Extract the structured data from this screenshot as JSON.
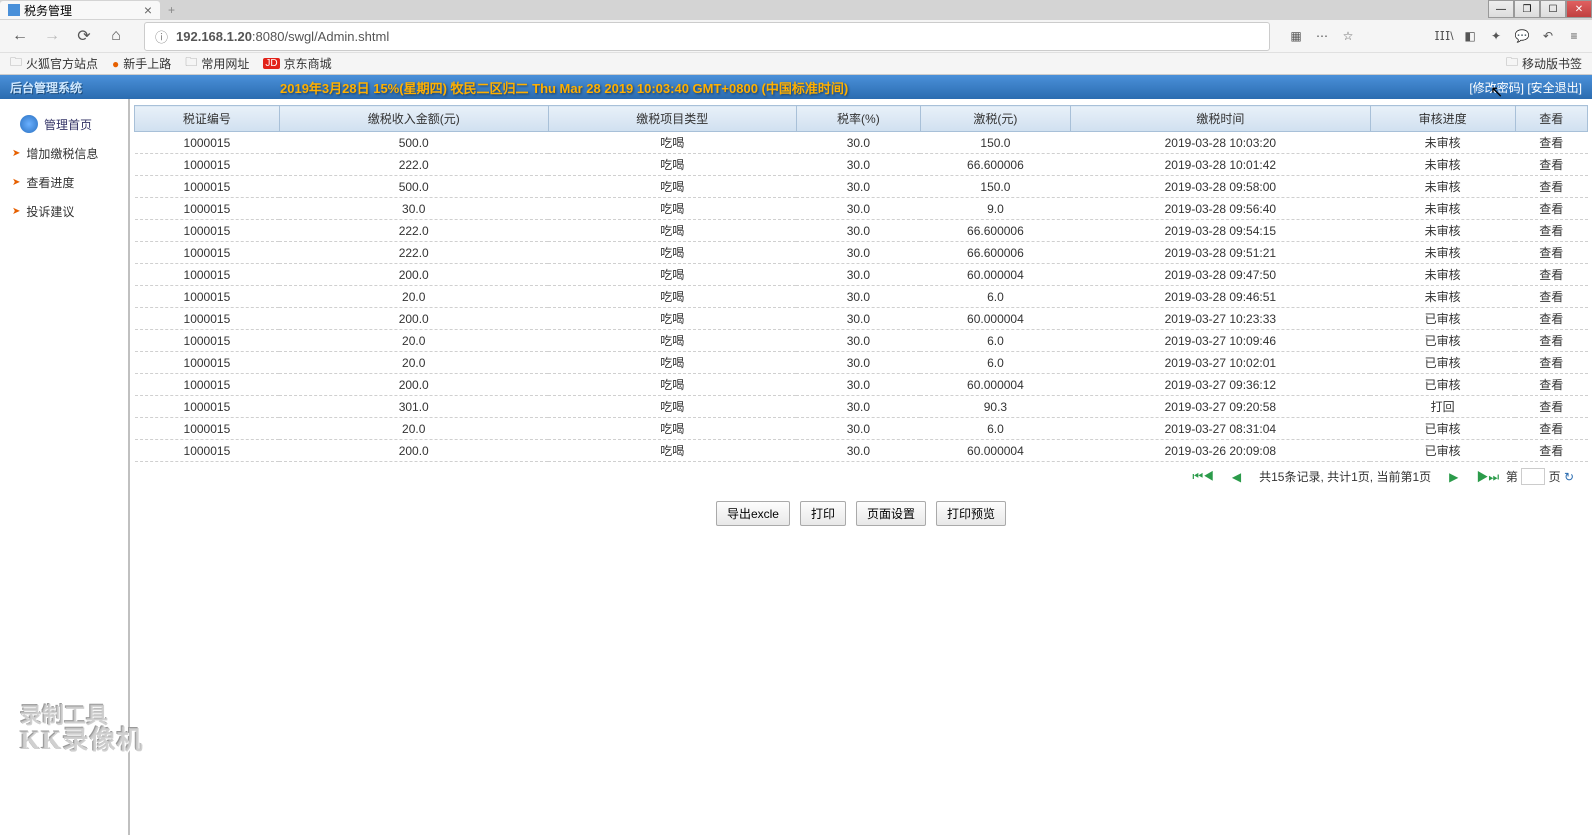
{
  "browser": {
    "tab_title": "税务管理",
    "url_display": "192.168.1.20:8080/swgl/Admin.shtml",
    "url_prefix": "192.168.1.20",
    "url_suffix": ":8080/swgl/Admin.shtml",
    "bookmarks": {
      "b1": "火狐官方站点",
      "b2": "新手上路",
      "b3": "常用网址",
      "b4": "京东商城",
      "right": "移动版书签"
    }
  },
  "app": {
    "logo": "后台管理系统",
    "marquee": "2019年3月28日 15%(星期四) 牧民二区归二 Thu Mar 28 2019 10:03:40 GMT+0800 (中国标准时间)",
    "change_pw": "[修改密码]",
    "logout": "[安全退出]"
  },
  "sidebar": {
    "home": "管理首页",
    "items": [
      {
        "label": "增加缴税信息"
      },
      {
        "label": "查看进度"
      },
      {
        "label": "投诉建议"
      }
    ]
  },
  "table": {
    "headers": {
      "id": "税证编号",
      "income": "缴税收入金额(元)",
      "type": "缴税项目类型",
      "rate": "税率(%)",
      "tax": "激税(元)",
      "time": "缴税时间",
      "status": "审核进度",
      "action": "查看"
    },
    "view_text": "查看",
    "rows": [
      {
        "id": "1000015",
        "income": "500.0",
        "type": "吃喝",
        "rate": "30.0",
        "tax": "150.0",
        "time": "2019-03-28 10:03:20",
        "status": "未审核"
      },
      {
        "id": "1000015",
        "income": "222.0",
        "type": "吃喝",
        "rate": "30.0",
        "tax": "66.600006",
        "time": "2019-03-28 10:01:42",
        "status": "未审核"
      },
      {
        "id": "1000015",
        "income": "500.0",
        "type": "吃喝",
        "rate": "30.0",
        "tax": "150.0",
        "time": "2019-03-28 09:58:00",
        "status": "未审核"
      },
      {
        "id": "1000015",
        "income": "30.0",
        "type": "吃喝",
        "rate": "30.0",
        "tax": "9.0",
        "time": "2019-03-28 09:56:40",
        "status": "未审核"
      },
      {
        "id": "1000015",
        "income": "222.0",
        "type": "吃喝",
        "rate": "30.0",
        "tax": "66.600006",
        "time": "2019-03-28 09:54:15",
        "status": "未审核"
      },
      {
        "id": "1000015",
        "income": "222.0",
        "type": "吃喝",
        "rate": "30.0",
        "tax": "66.600006",
        "time": "2019-03-28 09:51:21",
        "status": "未审核"
      },
      {
        "id": "1000015",
        "income": "200.0",
        "type": "吃喝",
        "rate": "30.0",
        "tax": "60.000004",
        "time": "2019-03-28 09:47:50",
        "status": "未审核"
      },
      {
        "id": "1000015",
        "income": "20.0",
        "type": "吃喝",
        "rate": "30.0",
        "tax": "6.0",
        "time": "2019-03-28 09:46:51",
        "status": "未审核"
      },
      {
        "id": "1000015",
        "income": "200.0",
        "type": "吃喝",
        "rate": "30.0",
        "tax": "60.000004",
        "time": "2019-03-27 10:23:33",
        "status": "已审核"
      },
      {
        "id": "1000015",
        "income": "20.0",
        "type": "吃喝",
        "rate": "30.0",
        "tax": "6.0",
        "time": "2019-03-27 10:09:46",
        "status": "已审核"
      },
      {
        "id": "1000015",
        "income": "20.0",
        "type": "吃喝",
        "rate": "30.0",
        "tax": "6.0",
        "time": "2019-03-27 10:02:01",
        "status": "已审核"
      },
      {
        "id": "1000015",
        "income": "200.0",
        "type": "吃喝",
        "rate": "30.0",
        "tax": "60.000004",
        "time": "2019-03-27 09:36:12",
        "status": "已审核"
      },
      {
        "id": "1000015",
        "income": "301.0",
        "type": "吃喝",
        "rate": "30.0",
        "tax": "90.3",
        "time": "2019-03-27 09:20:58",
        "status": "打回"
      },
      {
        "id": "1000015",
        "income": "20.0",
        "type": "吃喝",
        "rate": "30.0",
        "tax": "6.0",
        "time": "2019-03-27 08:31:04",
        "status": "已审核"
      },
      {
        "id": "1000015",
        "income": "200.0",
        "type": "吃喝",
        "rate": "30.0",
        "tax": "60.000004",
        "time": "2019-03-26 20:09:08",
        "status": "已审核"
      }
    ]
  },
  "pager": {
    "summary": "共15条记录, 共计1页, 当前第1页",
    "label_page_prefix": "第",
    "label_page_suffix": "页",
    "refresh_icon": "↻"
  },
  "actions": {
    "export": "导出excle",
    "print": "打印",
    "page_setup": "页面设置",
    "print_preview": "打印预览"
  },
  "watermark": {
    "line1": "录制工具",
    "line2": "KK录像机"
  }
}
